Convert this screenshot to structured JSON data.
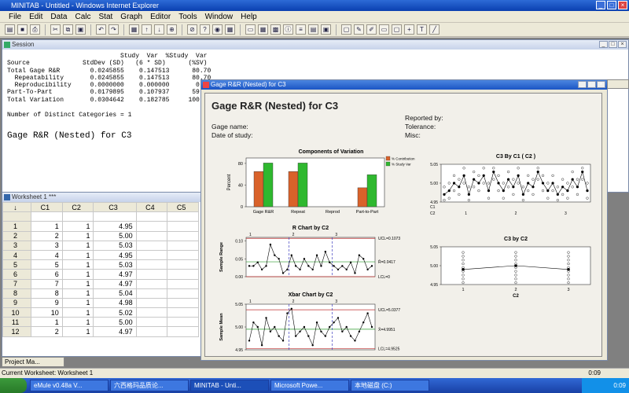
{
  "app": {
    "title": "MINITAB - Untitled",
    "title_extra": "- Windows Internet Explorer"
  },
  "menu": [
    "File",
    "Edit",
    "Data",
    "Calc",
    "Stat",
    "Graph",
    "Editor",
    "Tools",
    "Window",
    "Help"
  ],
  "session": {
    "title": "Session",
    "header1": "                              Study  Var  %Study  Var",
    "header2": "Source              StdDev (SD)   (6 * SD)      (%SV)",
    "rows": [
      "Total Gage R&R        0.0245855    0.147513      80.70",
      "  Repeatability       0.0245855    0.147513      80.70",
      "  Reproducibility     0.0000000    0.000000       0.00",
      "Part-To-Part          0.0179895    0.107937      59.05",
      "Total Variation       0.0304642    0.182785     100.00"
    ],
    "distinct": "Number of Distinct Categories = 1",
    "heading": "Gage R&R (Nested) for C3"
  },
  "worksheet": {
    "title": "Worksheet 1 ***",
    "columns": [
      "C1",
      "C2",
      "C3",
      "C4",
      "C5"
    ],
    "rows": [
      [
        "1",
        "1",
        "1",
        "4.95"
      ],
      [
        "2",
        "2",
        "1",
        "5.00"
      ],
      [
        "3",
        "3",
        "1",
        "5.03"
      ],
      [
        "4",
        "4",
        "1",
        "4.95"
      ],
      [
        "5",
        "5",
        "1",
        "5.03"
      ],
      [
        "6",
        "6",
        "1",
        "4.97"
      ],
      [
        "7",
        "7",
        "1",
        "4.97"
      ],
      [
        "8",
        "8",
        "1",
        "5.04"
      ],
      [
        "9",
        "9",
        "1",
        "4.98"
      ],
      [
        "10",
        "10",
        "1",
        "5.02"
      ],
      [
        "11",
        "1",
        "1",
        "5.00"
      ],
      [
        "12",
        "2",
        "1",
        "4.97"
      ]
    ]
  },
  "graph": {
    "window_title": "Gage R&R (Nested) for C3",
    "title": "Gage R&R (Nested) for C3",
    "gage_name": "Gage name:",
    "date": "Date of study:",
    "reported": "Reported by:",
    "tolerance": "Tolerance:",
    "misc": "Misc:",
    "components": {
      "title": "Components of Variation",
      "ylabel": "Percent",
      "legend": [
        "% Contribution",
        "% Study Var"
      ],
      "colors": [
        "#d9622a",
        "#2fb82f"
      ]
    },
    "rchart": {
      "title": "R Chart by C2",
      "ylabel": "Sample Range",
      "ucl": "UCL=0.1073",
      "rbar": "R̄=0.0417",
      "lcl": "LCL=0"
    },
    "xbar": {
      "title": "Xbar Chart by C2",
      "ylabel": "Sample Mean",
      "ucl": "UCL=5.0377",
      "xbar": "X̄=4.9951",
      "lcl": "LCL=4.9525"
    },
    "byc1": {
      "title": "C3 By C1 ( C2 )"
    },
    "byc2": {
      "title": "C3 by C2",
      "xlabel": "C2"
    }
  },
  "chart_data": [
    {
      "type": "bar",
      "title": "Components of Variation",
      "ylabel": "Percent",
      "categories": [
        "Gage R&R",
        "Repeat",
        "Reprod",
        "Part-to-Part"
      ],
      "series": [
        {
          "name": "% Contribution",
          "values": [
            65,
            65,
            0,
            35
          ]
        },
        {
          "name": "% Study Var",
          "values": [
            80.7,
            80.7,
            0.0,
            59.05
          ]
        }
      ],
      "ylim": [
        0,
        90
      ],
      "yticks": [
        0,
        40,
        80
      ]
    },
    {
      "type": "line",
      "title": "R Chart by C2",
      "ylabel": "Sample Range",
      "groups": [
        "1",
        "2",
        "3"
      ],
      "values": [
        0.03,
        0.03,
        0.04,
        0.02,
        0.03,
        0.09,
        0.06,
        0.05,
        0.01,
        0.02,
        0.06,
        0.03,
        0.02,
        0.05,
        0.03,
        0.02,
        0.06,
        0.03,
        0.07,
        0.04,
        0.03,
        0.02,
        0.03,
        0.02,
        0.04,
        0.01,
        0.06,
        0.05,
        0.02,
        0.03
      ],
      "ylim": [
        0,
        0.11
      ],
      "yticks": [
        0.0,
        0.05,
        0.1
      ],
      "ucl": 0.1073,
      "center": 0.0417,
      "lcl": 0
    },
    {
      "type": "line",
      "title": "Xbar Chart by C2",
      "ylabel": "Sample Mean",
      "groups": [
        "1",
        "2",
        "3"
      ],
      "values": [
        4.97,
        5.01,
        5.0,
        4.96,
        5.02,
        4.99,
        5.0,
        4.98,
        4.97,
        5.03,
        5.04,
        4.98,
        4.99,
        5.0,
        4.98,
        4.96,
        5.01,
        4.99,
        4.98,
        5.0,
        5.01,
        5.02,
        4.99,
        5.0,
        4.98,
        4.97,
        4.99,
        5.01,
        5.03,
        5.0
      ],
      "ylim": [
        4.95,
        5.05
      ],
      "yticks": [
        4.95,
        5.0,
        5.05
      ],
      "ucl": 5.0377,
      "center": 4.9951,
      "lcl": 4.9525
    },
    {
      "type": "scatter",
      "title": "C3 By C1 ( C2 )",
      "ylim": [
        4.95,
        5.05
      ],
      "yticks": [
        4.95,
        5.0,
        5.05
      ],
      "means": [
        4.97,
        4.98,
        5.0,
        4.99,
        5.02,
        4.97,
        5.01,
        5.0,
        5.02,
        4.98,
        5.03,
        5.0,
        4.98,
        5.01,
        4.99,
        5.02,
        4.97,
        5.0,
        4.99,
        5.03,
        5.0,
        4.98,
        5.0,
        4.97,
        4.99,
        4.98,
        5.01,
        4.99,
        5.03,
        4.98
      ]
    },
    {
      "type": "scatter",
      "title": "C3 by C2",
      "xlabel": "C2",
      "categories": [
        "1",
        "2",
        "3"
      ],
      "means": [
        4.99,
        5.0,
        4.99
      ],
      "ylim": [
        4.95,
        5.05
      ],
      "yticks": [
        4.95,
        5.0,
        5.05
      ]
    }
  ],
  "status": {
    "worksheet": "Current Worksheet: Worksheet 1",
    "time": "0:09"
  },
  "taskbar": {
    "items": [
      "eMule v0.48a V...",
      "六西格玛品质论...",
      "MINITAB - Unti...",
      "Microsoft Powe...",
      "本地磁盘 (C:)"
    ],
    "clock": "0:09"
  }
}
